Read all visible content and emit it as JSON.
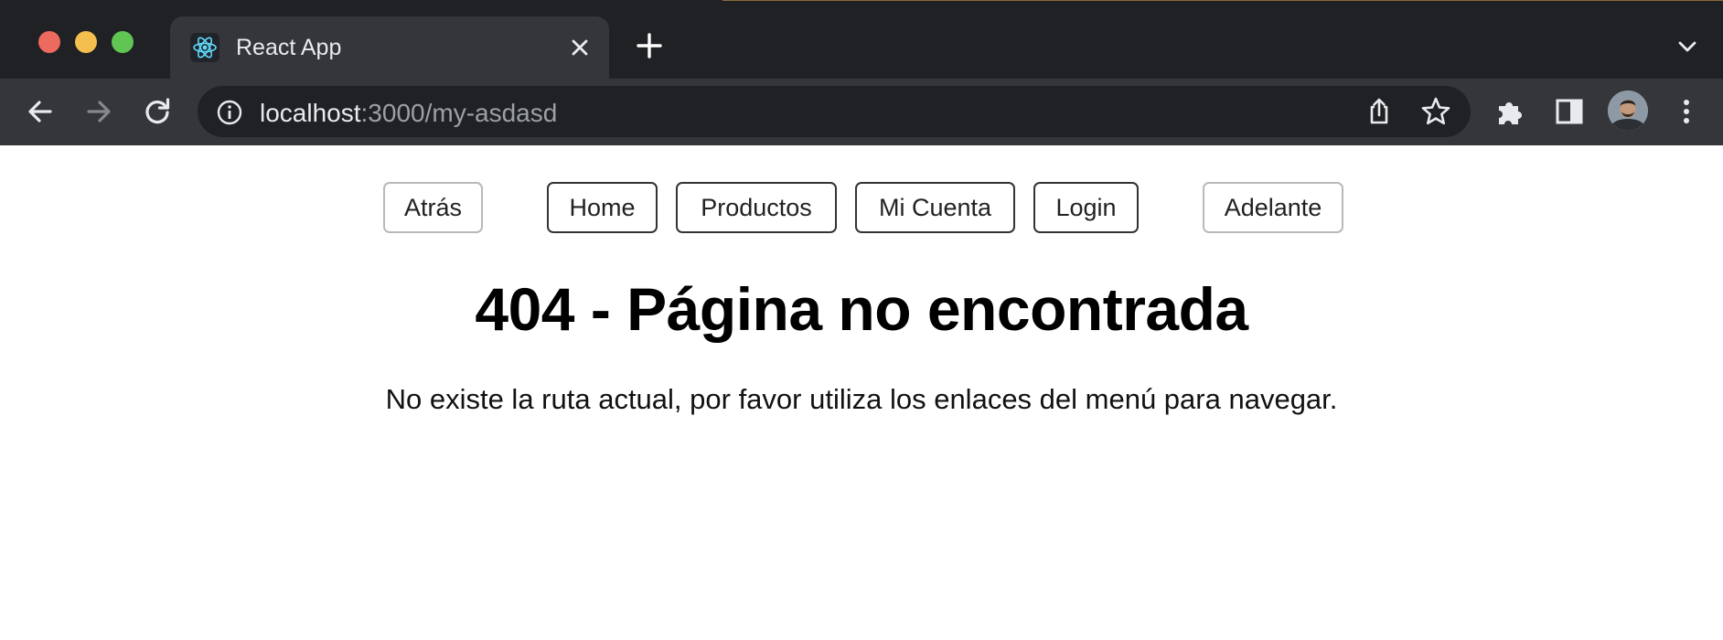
{
  "window": {
    "controls": [
      "close",
      "minimize",
      "zoom"
    ]
  },
  "tab": {
    "title": "React App",
    "favicon": "react-logo-icon"
  },
  "address_bar": {
    "host": "localhost",
    "path": ":3000/my-asdasd"
  },
  "toolbar_icons": [
    "back-icon",
    "forward-icon",
    "reload-icon",
    "share-icon",
    "star-icon",
    "extensions-icon",
    "side-panel-icon",
    "profile-avatar",
    "kebab-menu-icon"
  ],
  "nav": {
    "back_label": "Atrás",
    "items": [
      "Home",
      "Productos",
      "Mi Cuenta",
      "Login"
    ],
    "forward_label": "Adelante"
  },
  "content": {
    "title": "404 - Página no encontrada",
    "message": "No existe la ruta actual, por favor utiliza los enlaces del menú para navegar."
  },
  "colors": {
    "tabstrip": "#202124",
    "toolbar": "#35363a",
    "omnibox": "#202124",
    "react_blue": "#61dafb"
  }
}
